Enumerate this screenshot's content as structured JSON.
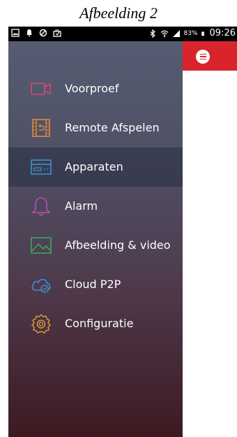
{
  "caption": "Afbeelding 2",
  "status_bar": {
    "battery": "83%",
    "time": "09:26",
    "left_icons": [
      "gallery-icon",
      "notification-bell-icon",
      "blocked-icon",
      "briefcase-icon"
    ],
    "right_icons": [
      "bluetooth-icon",
      "wifi-icon",
      "signal-icon",
      "battery-icon"
    ]
  },
  "header": {
    "accent_color": "#d9242b",
    "menu_icon": "hamburger-menu-icon"
  },
  "drawer": {
    "items": [
      {
        "label": "Voorproef",
        "icon": "camera-preview-icon",
        "icon_color": "#d64a68",
        "active": false
      },
      {
        "label": "Remote Afspelen",
        "icon": "film-playback-icon",
        "icon_color": "#e08a3a",
        "active": false
      },
      {
        "label": "Apparaten",
        "icon": "recorder-device-icon",
        "icon_color": "#3f8fd4",
        "active": true
      },
      {
        "label": "Alarm",
        "icon": "bell-icon",
        "icon_color": "#c04ab8",
        "active": false
      },
      {
        "label": "Afbeelding & video",
        "icon": "image-icon",
        "icon_color": "#3aa85a",
        "active": false
      },
      {
        "label": "Cloud P2P",
        "icon": "cloud-icon",
        "icon_color": "#3f8fd4",
        "active": false
      },
      {
        "label": "Configuratie",
        "icon": "gear-icon",
        "icon_color": "#d99a3a",
        "active": false
      }
    ]
  }
}
